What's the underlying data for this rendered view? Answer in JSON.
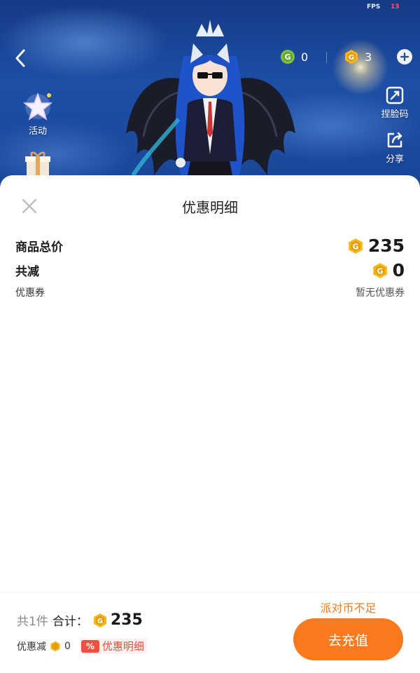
{
  "status": {
    "fps_label": "FPS",
    "fps_value": "13"
  },
  "header": {
    "green_coin_count": "0",
    "gold_coin_count": "3",
    "colors": {
      "green_coin": "#7cc242",
      "gold_coin": "#f5b719",
      "accent": "#fb7a1f"
    }
  },
  "side_left": {
    "activity_label": "活动"
  },
  "side_right": {
    "pinch_label": "捏脸码",
    "share_label": "分享"
  },
  "sheet": {
    "title": "优惠明细",
    "total_label": "商品总价",
    "total_value": "235",
    "reduce_label": "共减",
    "reduce_value": "0",
    "coupon_label": "优惠券",
    "coupon_value": "暂无优惠券"
  },
  "footer": {
    "count_label": "共1件",
    "sum_label": "合计：",
    "sum_value": "235",
    "discount_label": "优惠减",
    "discount_value": "0",
    "pct_badge": "%",
    "detail_link": "优惠明细",
    "insufficient_text": "派对币不足",
    "recharge_button": "去充值"
  },
  "icons": [
    "back-icon",
    "green-coin-icon",
    "gold-coin-icon",
    "plus-icon",
    "activity-star-icon",
    "gift-icon",
    "pinch-face-icon",
    "share-icon",
    "close-icon"
  ]
}
